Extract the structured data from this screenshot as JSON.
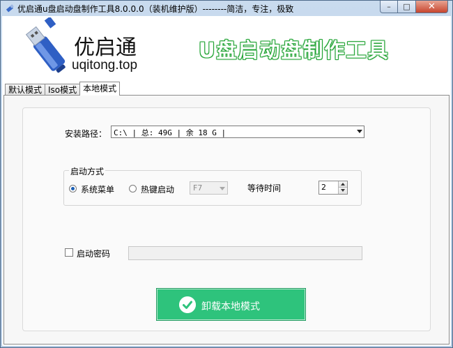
{
  "window": {
    "title": "优启通u盘启动盘制作工具8.0.0.0（装机维护版）--------简洁，专注，极致",
    "buttons": {
      "minimize_glyph": "–",
      "maximize_glyph": "□",
      "close_glyph": "✕"
    }
  },
  "header": {
    "brand_name": "优启通",
    "brand_url": "uqitong.top",
    "slogan": "U盘启动盘制作工具"
  },
  "tabs": [
    {
      "label": "默认模式",
      "active": false
    },
    {
      "label": "Iso模式",
      "active": false
    },
    {
      "label": "本地模式",
      "active": true
    }
  ],
  "install_path": {
    "label": "安装路径：",
    "value": "C:\\ | 总: 49G | 余 18 G |"
  },
  "boot_mode": {
    "group_title": "启动方式",
    "option_menu": "系统菜单",
    "option_hotkey": "热键启动",
    "selected": "系统菜单",
    "hotkey_value": "F7",
    "wait_label": "等待时间",
    "wait_value": "2"
  },
  "boot_password": {
    "label": "启动密码",
    "checked": false,
    "value": ""
  },
  "action": {
    "uninstall_label": "卸载本地模式"
  },
  "colors": {
    "accent_green": "#2ec37c",
    "slogan_green": "#22a334",
    "close_red": "#c7452e"
  }
}
